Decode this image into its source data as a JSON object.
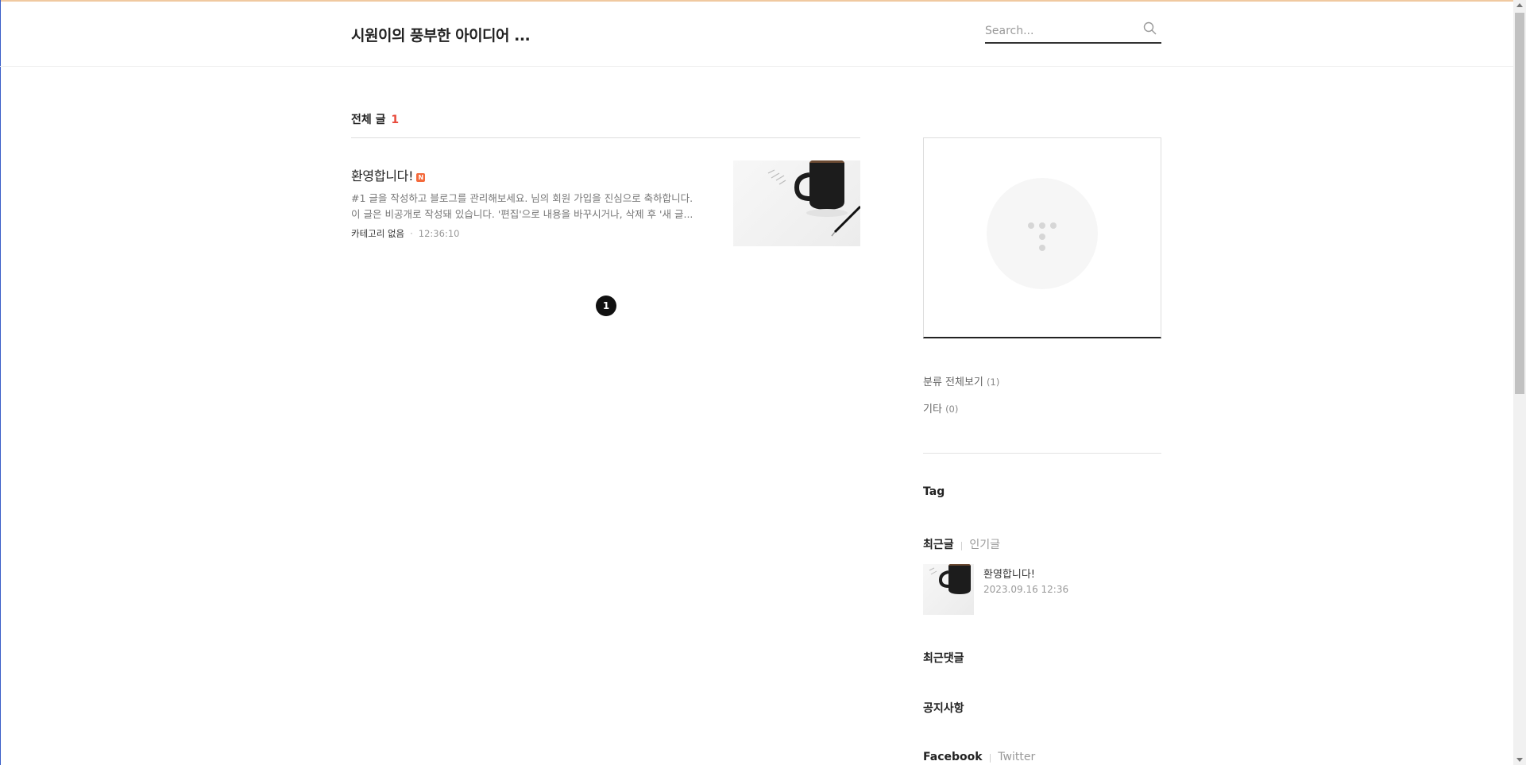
{
  "header": {
    "blog_title": "시원이의 풍부한 아이디어 ...",
    "search_placeholder": "Search..."
  },
  "list": {
    "label": "전체 글",
    "count": "1"
  },
  "post": {
    "title": "환영합니다!",
    "new_badge": "N",
    "summary_line1": "#1 글을 작성하고 블로그를 관리해보세요. 님의 회원 가입을 진심으로 축하합니다.",
    "summary_line2": "이 글은 비공개로 작성돼 있습니다. '편집'으로 내용을 바꾸시거나, 삭제 후 '새 글...",
    "category": "카테고리 없음",
    "separator": "·",
    "time": "12:36:10"
  },
  "pagination": {
    "current": "1"
  },
  "sidebar": {
    "categories": [
      {
        "label": "분류 전체보기",
        "count": "(1)"
      },
      {
        "label": "기타",
        "count": "(0)"
      }
    ],
    "tag_heading": "Tag",
    "recent_tabs": {
      "active": "최근글",
      "separator": "|",
      "inactive": "인기글"
    },
    "recent_post": {
      "title": "환영합니다!",
      "date": "2023.09.16 12:36"
    },
    "recent_comments_heading": "최근댓글",
    "notice_heading": "공지사항",
    "social_tabs": {
      "active": "Facebook",
      "separator": "|",
      "inactive": "Twitter"
    }
  }
}
